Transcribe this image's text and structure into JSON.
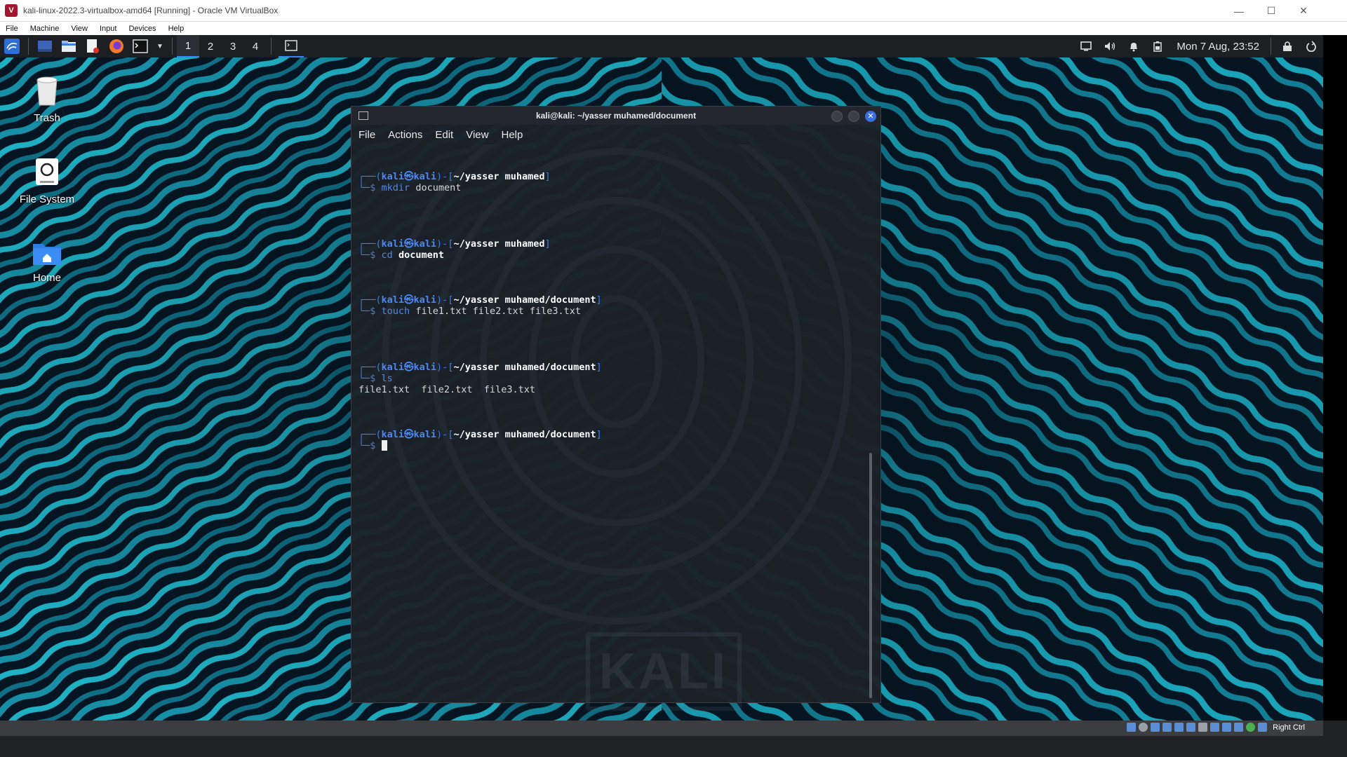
{
  "host": {
    "window_title": "kali-linux-2022.3-virtualbox-amd64 [Running] - Oracle VM VirtualBox",
    "menu": [
      "File",
      "Machine",
      "View",
      "Input",
      "Devices",
      "Help"
    ],
    "status_right_ctrl": "Right Ctrl"
  },
  "panel": {
    "workspaces": [
      "1",
      "2",
      "3",
      "4"
    ],
    "active_workspace": "1",
    "clock": "Mon 7 Aug, 23:52",
    "icons": [
      "kali-menu-icon",
      "show-desktop-icon",
      "file-manager-icon",
      "text-editor-icon",
      "firefox-icon",
      "terminal-icon",
      "dropdown-icon",
      "terminal-window-icon",
      "display-icon",
      "volume-icon",
      "notification-bell-icon",
      "battery-icon",
      "lock-icon",
      "power-icon"
    ]
  },
  "desktop": {
    "icons": [
      {
        "label": "Trash",
        "icon": "trash-icon"
      },
      {
        "label": "File System",
        "icon": "drive-icon"
      },
      {
        "label": "Home",
        "icon": "home-folder-icon"
      }
    ]
  },
  "terminal": {
    "title": "kali@kali: ~/yasser muhamed/document",
    "menu": [
      "File",
      "Actions",
      "Edit",
      "View",
      "Help"
    ],
    "user": "kali",
    "host": "kali",
    "prompt_symbol": "$",
    "blocks": [
      {
        "cwd": "~/yasser muhamed",
        "cmd": "mkdir",
        "args": "document",
        "args_bold": false,
        "output": ""
      },
      {
        "cwd": "~/yasser muhamed",
        "cmd": "cd",
        "args": "document",
        "args_bold": true,
        "output": ""
      },
      {
        "cwd": "~/yasser muhamed/document",
        "cmd": "touch",
        "args": "file1.txt file2.txt file3.txt",
        "args_bold": false,
        "output": ""
      },
      {
        "cwd": "~/yasser muhamed/document",
        "cmd": "ls",
        "args": "",
        "args_bold": false,
        "output": "file1.txt  file2.txt  file3.txt"
      }
    ],
    "final_cwd": "~/yasser muhamed/document",
    "watermark": "KALI"
  },
  "colors": {
    "accent": "#3a82f7",
    "prompt_blue": "#3e7ce8",
    "terminal_bg": "#1c2128",
    "wallpaper_teal": "#1fa3b8",
    "close_button": "#3a6fe0"
  }
}
